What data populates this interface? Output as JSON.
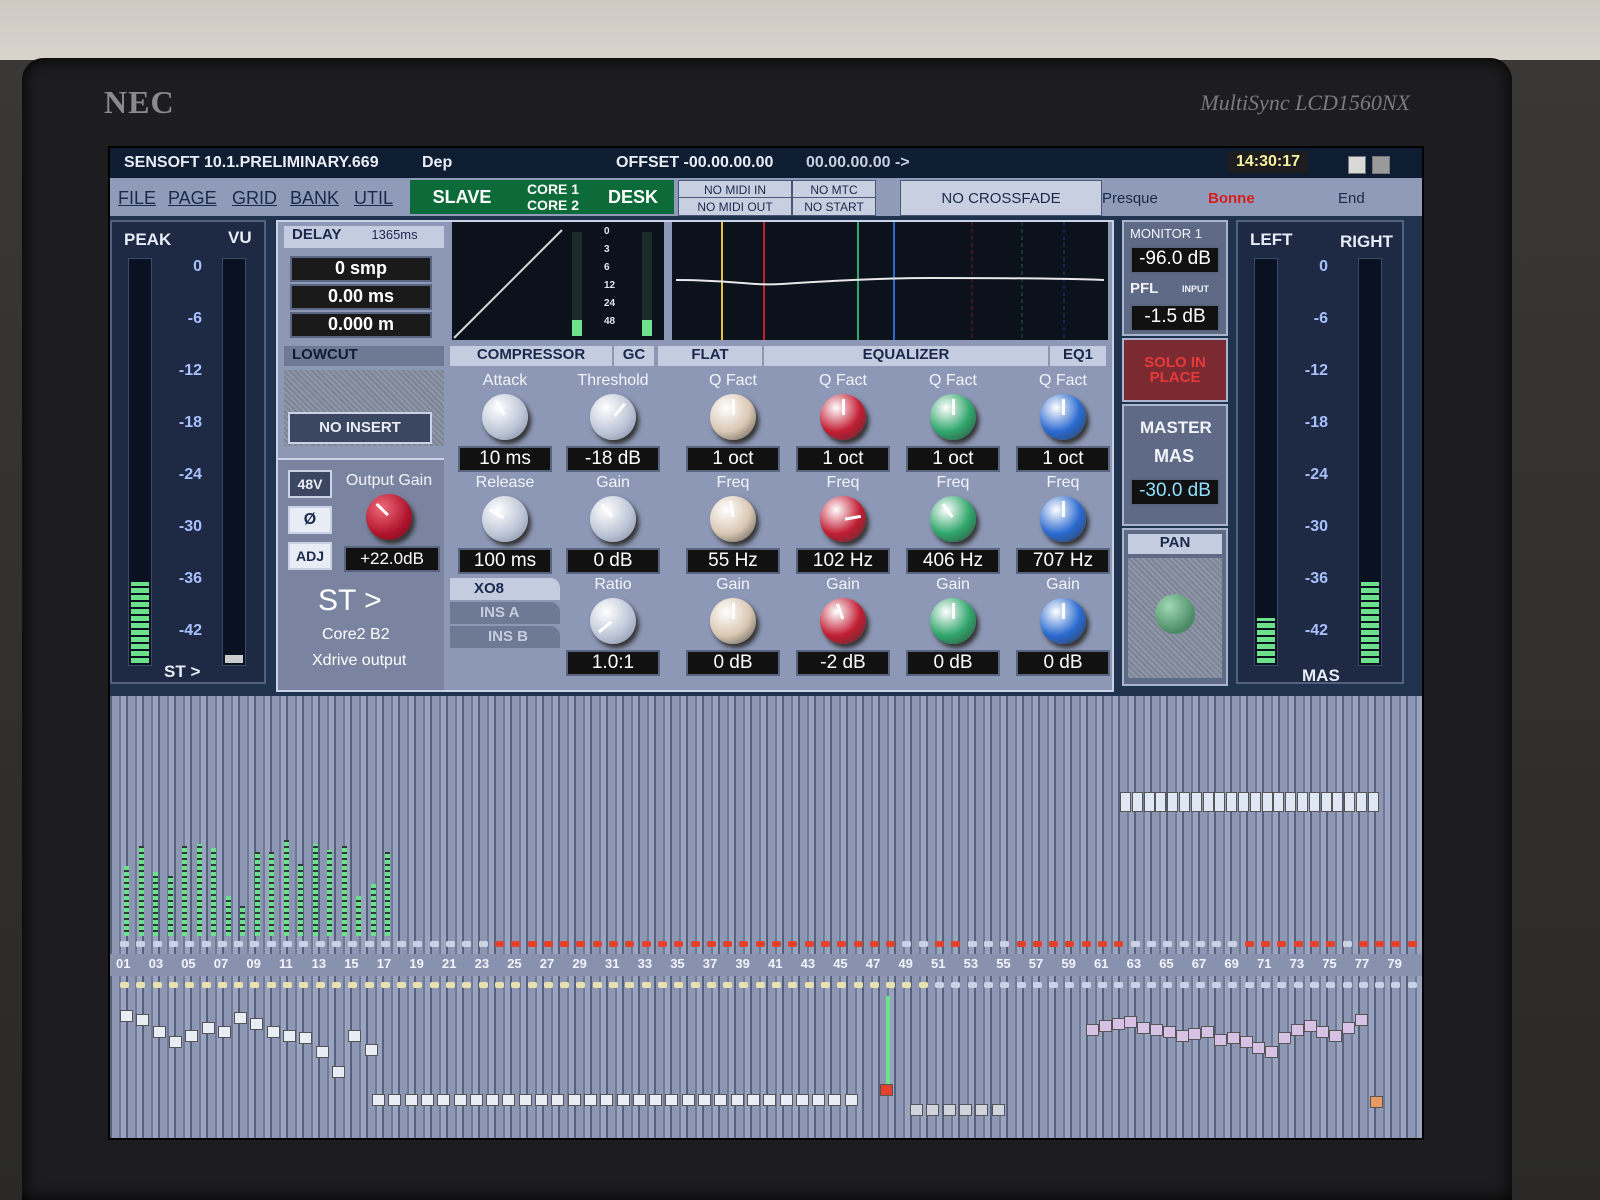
{
  "monitor": {
    "brand": "NEC",
    "model": "MultiSync LCD1560NX"
  },
  "titlebar": {
    "app": "SENSOFT 10.1.PRELIMINARY.669",
    "scene_name": "Dep",
    "offset_label": "OFFSET -00.00.00.00",
    "timecode": "00.00.00.00 ->",
    "clock": "14:30:17"
  },
  "menu": {
    "items": [
      "FILE",
      "PAGE",
      "GRID",
      "BANK",
      "UTIL"
    ]
  },
  "sync": {
    "slave": "SLAVE",
    "core1": "CORE 1",
    "core2": "CORE 2",
    "desk": "DESK"
  },
  "midi": {
    "midi_in": "NO MIDI IN",
    "midi_out": "NO MIDI OUT",
    "mtc": "NO MTC",
    "start": "NO START",
    "crossfade": "NO CROSSFADE"
  },
  "scenes": {
    "prev": "Presque",
    "current": "Bonne",
    "next": "End"
  },
  "left_meter": {
    "peak": "PEAK",
    "vu": "VU",
    "scale": [
      "0",
      "-6",
      "-12",
      "-18",
      "-24",
      "-30",
      "-36",
      "-42"
    ],
    "source": "ST >",
    "peak_level": 0.2,
    "vu_level": 0.02
  },
  "right_meter": {
    "left": "LEFT",
    "right": "RIGHT",
    "scale": [
      "0",
      "-6",
      "-12",
      "-18",
      "-24",
      "-30",
      "-36",
      "-42"
    ],
    "source": "MAS",
    "left_level": 0.11,
    "right_level": 0.2
  },
  "delay": {
    "label": "DELAY",
    "max": "1365ms",
    "samples": "0 smp",
    "ms": "0.00 ms",
    "meters": "0.000 m"
  },
  "dyn_scale": [
    "0",
    "3",
    "6",
    "12",
    "24",
    "48"
  ],
  "lowcut": "LOWCUT",
  "no_insert": "NO INSERT",
  "input": {
    "phantom": "48V",
    "phase": "Ø",
    "adj": "ADJ",
    "output_gain_label": "Output Gain",
    "output_gain": "+22.0dB",
    "route": "ST >",
    "core": "Core2 B2",
    "output": "Xdrive output"
  },
  "inserts": [
    "XO8",
    "INS A",
    "INS B"
  ],
  "compressor": {
    "header": "COMPRESSOR",
    "gc": "GC",
    "attack": {
      "label": "Attack",
      "value": "10 ms"
    },
    "threshold": {
      "label": "Threshold",
      "value": "-18 dB"
    },
    "release": {
      "label": "Release",
      "value": "100 ms"
    },
    "gain": {
      "label": "Gain",
      "value": "0 dB"
    },
    "ratio": {
      "label": "Ratio",
      "value": "1.0:1"
    }
  },
  "eq": {
    "flat": "FLAT",
    "header": "EQUALIZER",
    "preset": "EQ1",
    "bands": [
      {
        "q_label": "Q Fact",
        "q": "1 oct",
        "freq_label": "Freq",
        "freq": "55 Hz",
        "gain_label": "Gain",
        "gain": "0 dB",
        "color": "#d9c7b2"
      },
      {
        "q_label": "Q Fact",
        "q": "1 oct",
        "freq_label": "Freq",
        "freq": "102 Hz",
        "gain_label": "Gain",
        "gain": "-2 dB",
        "color": "#c21d33"
      },
      {
        "q_label": "Q Fact",
        "q": "1 oct",
        "freq_label": "Freq",
        "freq": "406 Hz",
        "gain_label": "Gain",
        "gain": "0 dB",
        "color": "#2fa66b"
      },
      {
        "q_label": "Q Fact",
        "q": "1 oct",
        "freq_label": "Freq",
        "freq": "707 Hz",
        "gain_label": "Gain",
        "gain": "0 dB",
        "color": "#2a6ad0"
      }
    ]
  },
  "monitor_panel": {
    "monitor": "MONITOR 1",
    "monitor_level": "-96.0 dB",
    "pfl": "PFL",
    "pfl_sub": "INPUT",
    "pfl_level": "-1.5 dB",
    "solo_in_place": "SOLO IN PLACE",
    "master": "MASTER",
    "mas": "MAS",
    "master_level": "-30.0 dB",
    "pan": "PAN"
  },
  "channels": {
    "labels": [
      "01",
      "03",
      "05",
      "07",
      "09",
      "11",
      "13",
      "15",
      "17",
      "19",
      "21",
      "23",
      "25",
      "27",
      "29",
      "31",
      "33",
      "35",
      "37",
      "39",
      "41",
      "43",
      "45",
      "47",
      "49",
      "51",
      "53",
      "55",
      "57",
      "59",
      "61",
      "63",
      "65",
      "67",
      "69",
      "71",
      "73",
      "75",
      "77",
      "79"
    ]
  },
  "colors": {
    "accent_green": "#0d6b3a",
    "scene_current": "#d81d1d",
    "meter_green": "#6ce08a"
  }
}
